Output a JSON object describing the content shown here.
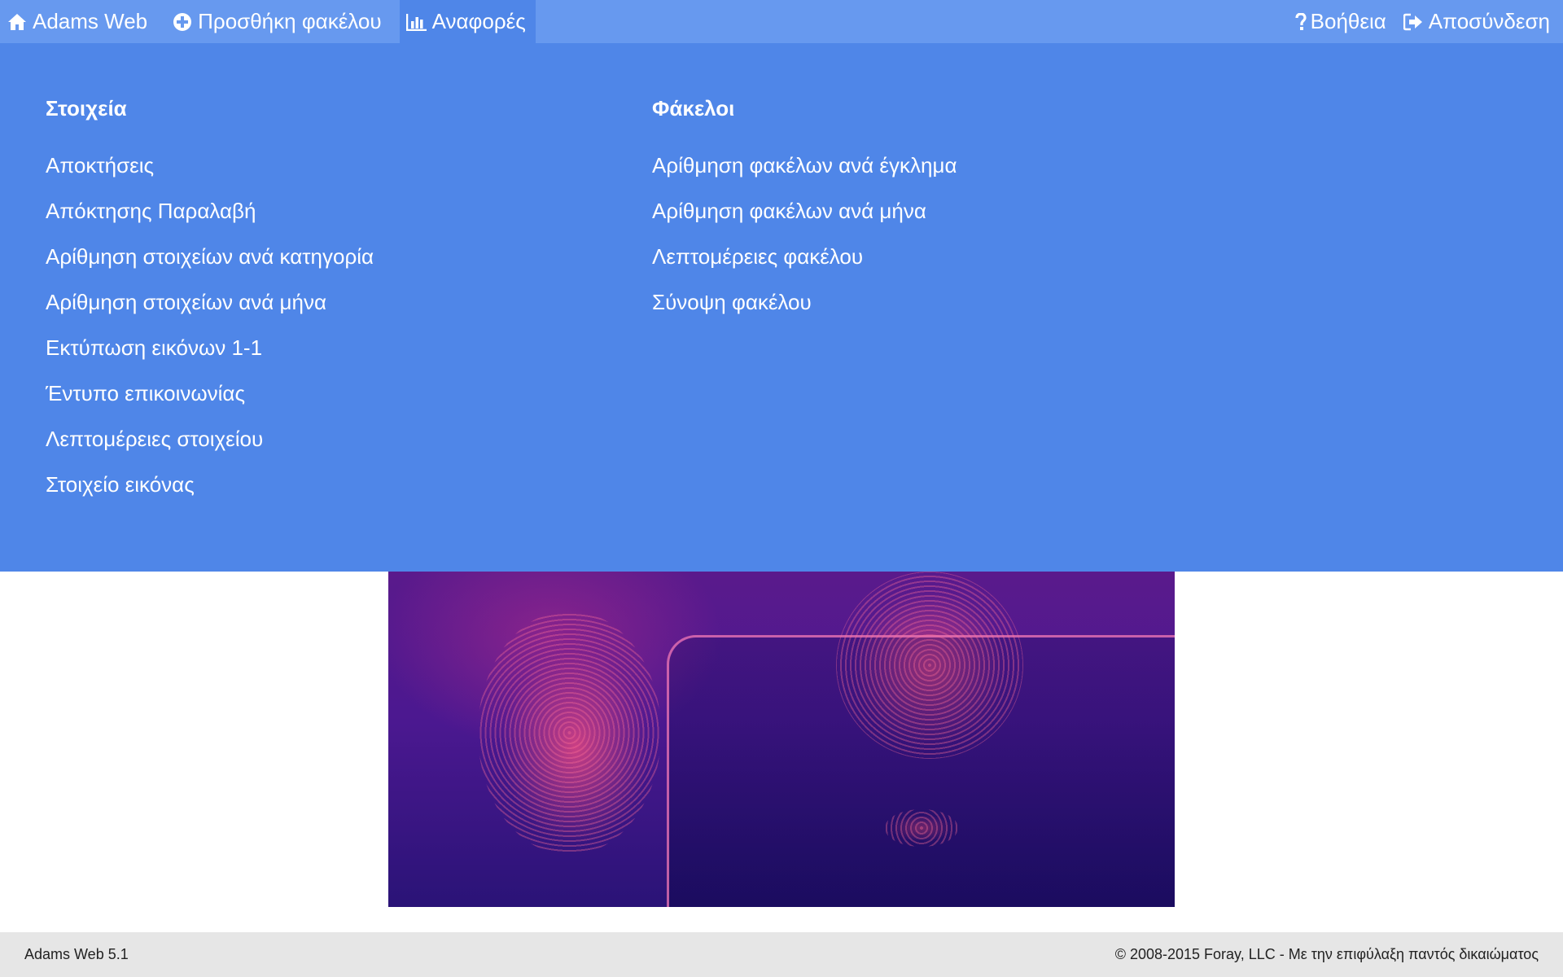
{
  "navbar": {
    "brand_label": "Adams Web",
    "add_case_label": "Προσθήκη φακέλου",
    "reports_label": "Αναφορές",
    "help_label": "Βοήθεια",
    "logout_label": "Αποσύνδεση",
    "icons": {
      "brand": "home-icon",
      "add_case": "plus-circle-icon",
      "reports": "bar-chart-icon",
      "help": "question-icon",
      "logout": "sign-out-icon"
    }
  },
  "reports_menu": {
    "items_section": {
      "heading": "Στοιχεία",
      "links": [
        "Αποκτήσεις",
        "Απόκτησης Παραλαβή",
        "Αρίθμηση στοιχείων ανά κατηγορία",
        "Αρίθμηση στοιχείων ανά μήνα",
        "Εκτύπωση εικόνων 1-1",
        "Έντυπο επικοινωνίας",
        "Λεπτομέρειες στοιχείου",
        "Στοιχείο εικόνας"
      ]
    },
    "cases_section": {
      "heading": "Φάκελοι",
      "links": [
        "Αρίθμηση φακέλων ανά έγκλημα",
        "Αρίθμηση φακέλων ανά μήνα",
        "Λεπτομέρειες φακέλου",
        "Σύνοψη φακέλου"
      ]
    }
  },
  "footer": {
    "version": "Adams Web 5.1",
    "copyright": "© 2008-2015 Foray, LLC - Με την επιφύλαξη παντός δικαιώματος"
  },
  "colors": {
    "navbar": "#6799ef",
    "menu_panel": "#4f86e8",
    "footer": "#e6e6e6"
  }
}
